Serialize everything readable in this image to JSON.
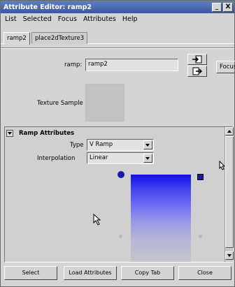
{
  "window": {
    "title": "Attribute Editor: ramp2"
  },
  "titlebar_buttons": {
    "minimize": "_",
    "close": "X"
  },
  "menu": [
    "List",
    "Selected",
    "Focus",
    "Attributes",
    "Help"
  ],
  "tabs": [
    "ramp2",
    "place2dTexture3"
  ],
  "node": {
    "label": "ramp:",
    "value": "ramp2",
    "focus_label": "Focus"
  },
  "texture_sample": {
    "label": "Texture Sample"
  },
  "ramp_attributes": {
    "header": "Ramp Attributes",
    "type_label": "Type",
    "type_value": "V Ramp",
    "interpolation_label": "Interpolation",
    "interpolation_value": "Linear"
  },
  "ramp_colors": {
    "top": "#1010e8",
    "bottom": "#c4c4cc",
    "marker": "#1a1aa8"
  },
  "buttons": [
    "Select",
    "Load Attributes",
    "Copy Tab",
    "Close"
  ]
}
